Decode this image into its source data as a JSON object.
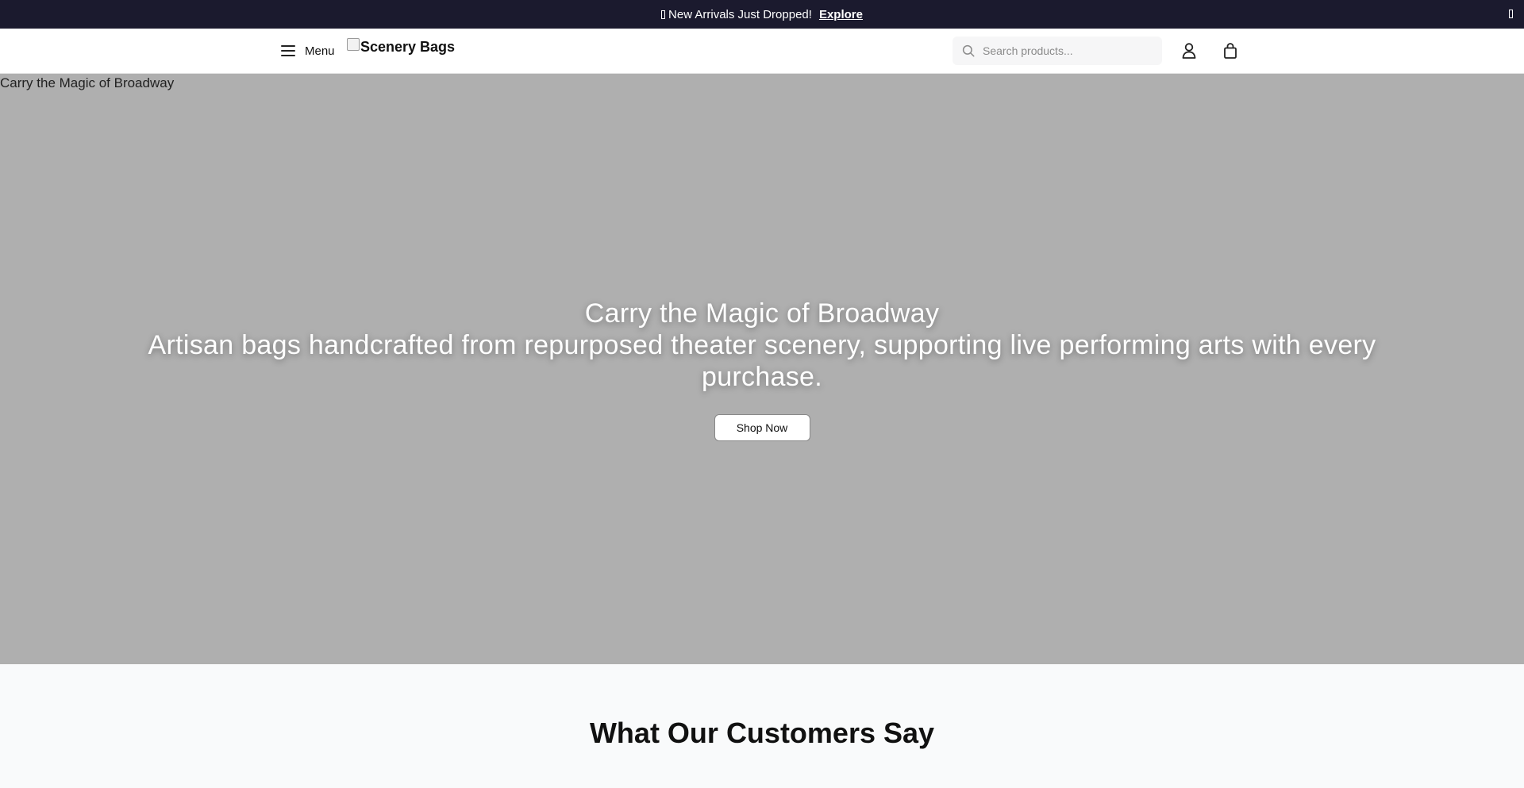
{
  "announcement": {
    "text": "New Arrivals Just Dropped!",
    "link_label": "Explore",
    "close_icon": "close-icon"
  },
  "header": {
    "menu_label": "Menu",
    "menu_icon": "hamburger-icon",
    "logo_text": "Scenery Bags",
    "search_placeholder": "Search products...",
    "search_value": "",
    "icons": [
      "search-icon",
      "account-icon",
      "shopping-bag-icon"
    ]
  },
  "hero": {
    "image_alt": "Carry the Magic of Broadway",
    "title": "Carry the Magic of Broadway",
    "subtitle": "Artisan bags handcrafted from repurposed theater scenery, supporting live performing arts with every purchase.",
    "cta_label": "Shop Now"
  },
  "testimonials": {
    "heading": "What Our Customers Say"
  },
  "colors": {
    "announcement_bg": "#1b1a2e",
    "hero_bg": "#afafaf",
    "testimonials_bg": "#f9fafb",
    "search_bg": "#f6f6f7"
  }
}
